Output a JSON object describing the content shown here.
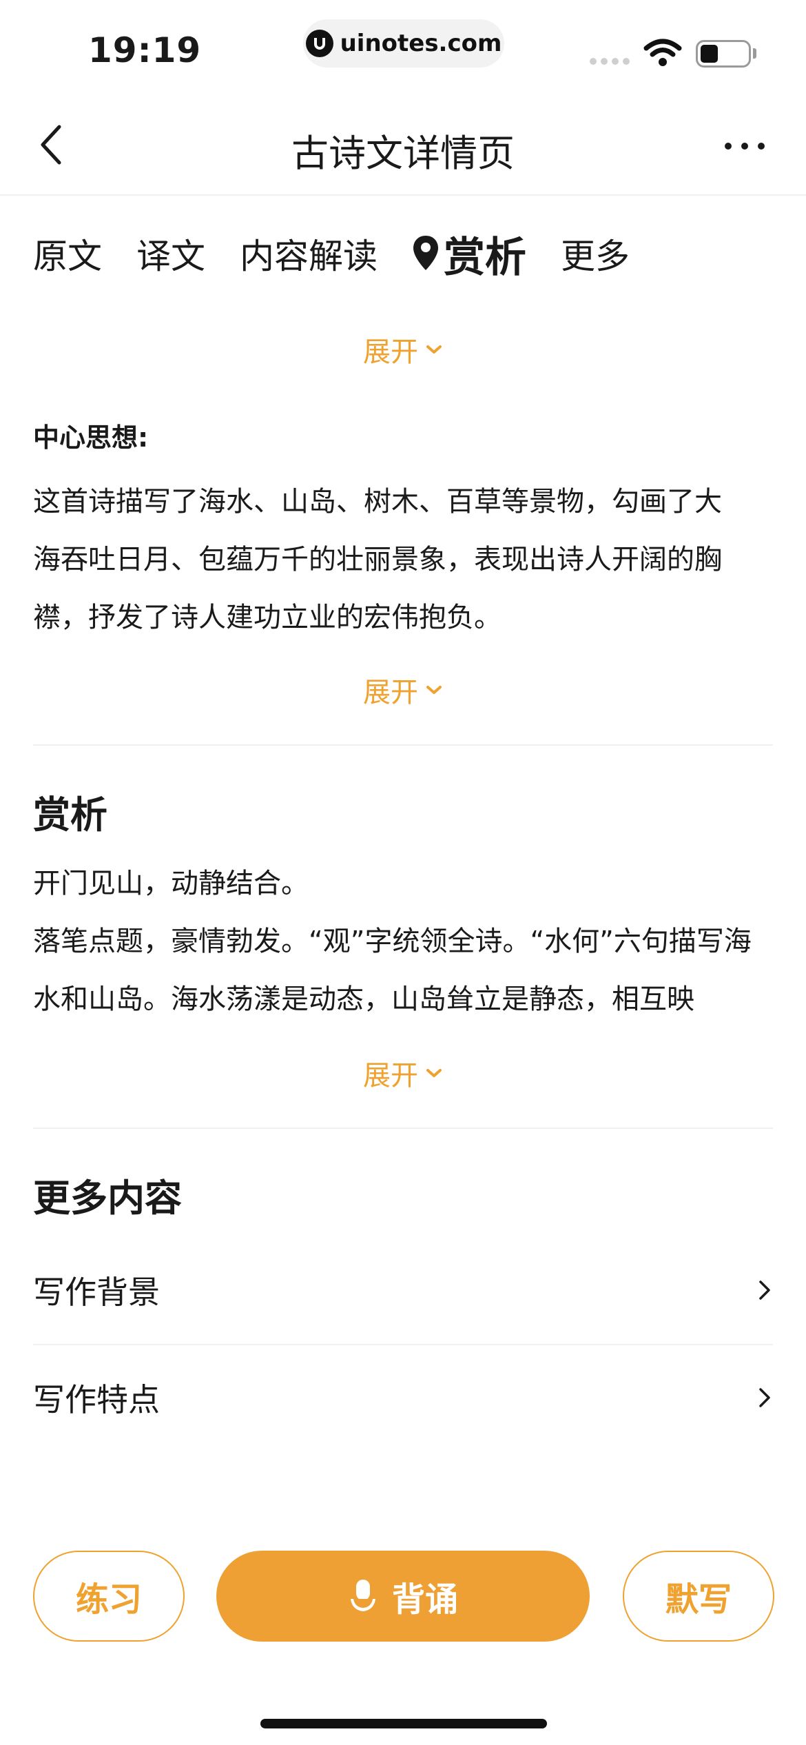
{
  "status_bar": {
    "time": "19:19",
    "url": "uinotes.com"
  },
  "nav": {
    "title": "古诗文详情页"
  },
  "tabs": [
    {
      "label": "原文"
    },
    {
      "label": "译文"
    },
    {
      "label": "内容解读"
    },
    {
      "label": "赏析",
      "active": true
    },
    {
      "label": "更多"
    }
  ],
  "expand_label": "展开",
  "center_idea": {
    "label": "中心思想:",
    "lines": [
      "这首诗描写了海水、山岛、树木、百草等景物，勾画了大",
      "海吞吐日月、包蕴万千的壮丽景象，表现出诗人开阔的胸",
      "襟，抒发了诗人建功立业的宏伟抱负。"
    ]
  },
  "appreciation": {
    "title": "赏析",
    "lines": [
      "开门见山，动静结合。",
      "落笔点题，豪情勃发。“观”字统领全诗。“水何”六句描写海",
      "水和山岛。海水荡漾是动态，山岛耸立是静态，相互映"
    ]
  },
  "more": {
    "title": "更多内容",
    "items": [
      {
        "label": "写作背景"
      },
      {
        "label": "写作特点"
      }
    ]
  },
  "bottom_bar": {
    "practice": "练习",
    "recite": "背诵",
    "dictation": "默写"
  },
  "colors": {
    "accent": "#efa22f",
    "primary_button": "#efa035"
  }
}
